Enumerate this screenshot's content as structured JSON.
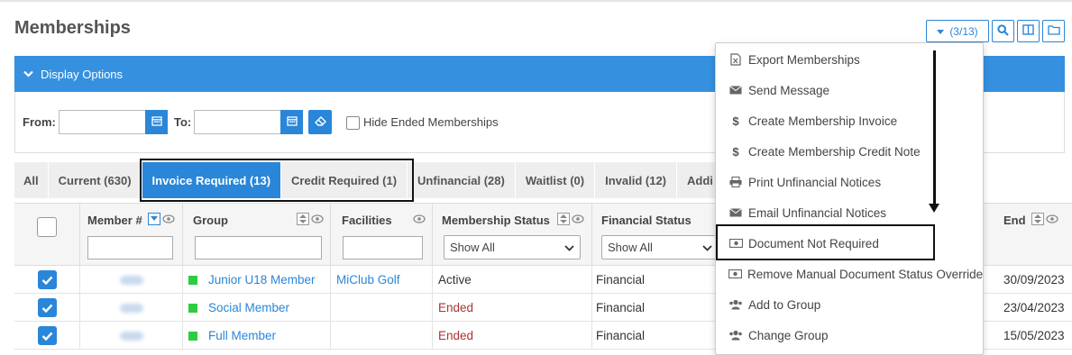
{
  "page": {
    "title": "Memberships"
  },
  "toolbar": {
    "count_label": "(3/13)"
  },
  "display_options": {
    "label": "Display Options"
  },
  "filters": {
    "from_label": "From:",
    "to_label": "To:",
    "hide_ended_label": "Hide Ended Memberships",
    "from_value": "",
    "to_value": ""
  },
  "tabs": [
    {
      "label": "All"
    },
    {
      "label": "Current (630)"
    },
    {
      "label": "Invoice Required (13)"
    },
    {
      "label": "Credit Required (1)"
    },
    {
      "label": "Unfinancial (28)"
    },
    {
      "label": "Waitlist (0)"
    },
    {
      "label": "Invalid (12)"
    },
    {
      "label": "Addi"
    }
  ],
  "columns": {
    "member": "Member #",
    "group": "Group",
    "facilities": "Facilities",
    "membership_status": "Membership Status",
    "financial_status": "Financial Status",
    "end": "End",
    "membership_status_filter": "Show All",
    "financial_status_filter": "Show All"
  },
  "rows": [
    {
      "group": "Junior U18 Member",
      "facility": "MiClub Golf",
      "status": "Active",
      "financial": "Financial",
      "end": "30/09/2023"
    },
    {
      "group": "Social Member",
      "facility": "",
      "status": "Ended",
      "financial": "Financial",
      "end": "23/04/2023"
    },
    {
      "group": "Full Member",
      "facility": "",
      "status": "Ended",
      "financial": "Financial",
      "end": "15/05/2023"
    }
  ],
  "menu": [
    {
      "label": "Export Memberships",
      "icon": "file-excel-icon"
    },
    {
      "label": "Send Message",
      "icon": "envelope-icon"
    },
    {
      "label": "Create Membership Invoice",
      "icon": "dollar-icon"
    },
    {
      "label": "Create Membership Credit Note",
      "icon": "dollar-icon"
    },
    {
      "label": "Print Unfinancial Notices",
      "icon": "print-icon"
    },
    {
      "label": "Email Unfinancial Notices",
      "icon": "envelope-icon"
    },
    {
      "label": "Document Not Required",
      "icon": "money-icon"
    },
    {
      "label": "Remove Manual Document Status Override",
      "icon": "money-icon"
    },
    {
      "label": "Add to Group",
      "icon": "users-icon"
    },
    {
      "label": "Change Group",
      "icon": "users-icon"
    }
  ],
  "colors": {
    "accent": "#2a86d8",
    "header_bar": "#3591e0",
    "status_green": "#2ecc40",
    "ended_red": "#aa3333"
  }
}
